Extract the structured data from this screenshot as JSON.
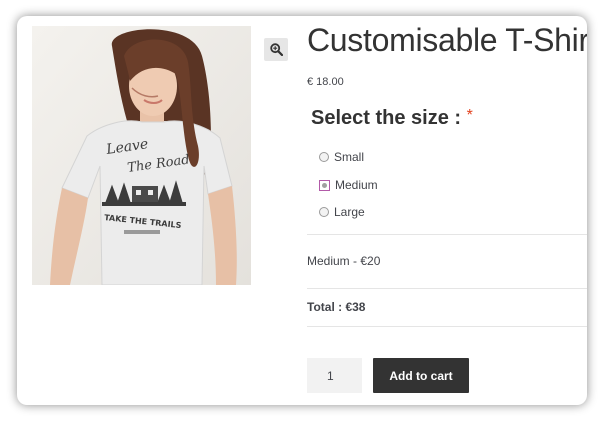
{
  "product": {
    "title": "Customisable T-Shirt",
    "price": "€ 18.00",
    "image_icon": "tshirt-model-photo",
    "print_text_top": "Leave The Road",
    "print_text_bottom": "TAKE THE TRAILS"
  },
  "zoom": {
    "icon": "magnifier-plus-icon"
  },
  "size": {
    "heading": "Select the size :",
    "required_mark": "*",
    "options": [
      {
        "label": "Small",
        "selected": false
      },
      {
        "label": "Medium",
        "selected": true
      },
      {
        "label": "Large",
        "selected": false
      }
    ]
  },
  "summary": {
    "selection": "Medium - €20",
    "total": "Total : €38"
  },
  "cart": {
    "quantity": "1",
    "add_label": "Add to cart"
  },
  "colors": {
    "button_bg": "#333333",
    "required": "#e2401c",
    "selected_radio_border": "#b25aa8"
  }
}
